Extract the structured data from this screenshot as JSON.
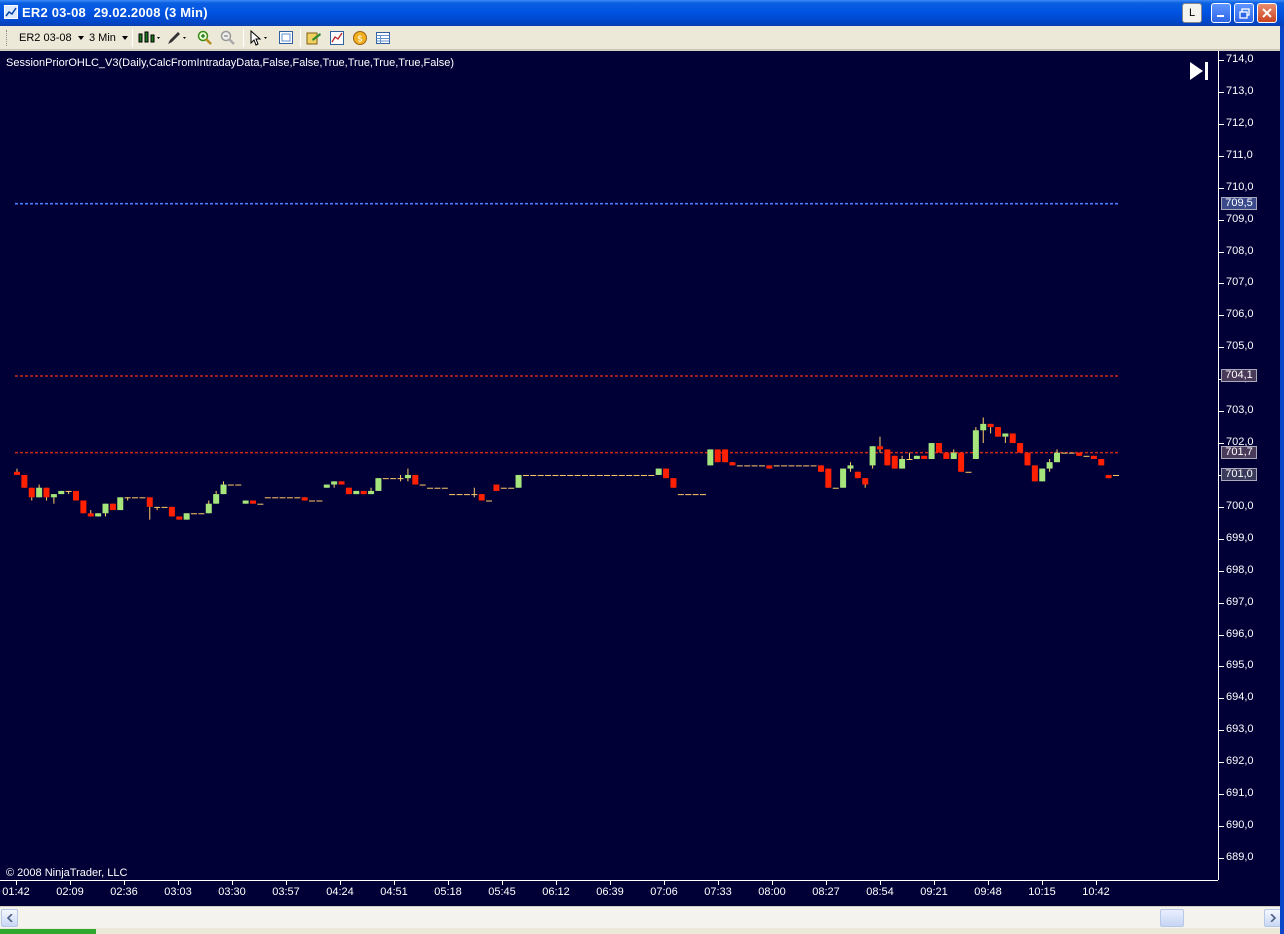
{
  "window": {
    "title": "ER2 03-08  29.02.2008 (3 Min)",
    "buttons": {
      "l_label": "L"
    }
  },
  "toolbar": {
    "instrument": "ER2 03-08",
    "interval": "3 Min",
    "icons": [
      "candlestick-style-icon",
      "drawing-pencil-icon",
      "zoom-in-icon",
      "zoom-out-icon",
      "cursor-icon",
      "data-box-icon",
      "properties-icon",
      "indicators-icon",
      "strategy-icon",
      "order-grid-icon"
    ]
  },
  "chart": {
    "indicator_label": "SessionPriorOHLC_V3(Daily,CalcFromIntradayData,False,False,True,True,True,True,False)",
    "copyright": "© 2008 NinjaTrader, LLC",
    "colors": {
      "background": "#000036",
      "up_bar": "#a6e57c",
      "down_bar": "#ff2000",
      "wick": "#ffcc66",
      "blue_line": "#4a7dff",
      "red_line": "#cc2a1a"
    }
  },
  "chart_data": {
    "type": "candlestick",
    "x_tick_labels": [
      "01:42",
      "02:09",
      "02:36",
      "03:03",
      "03:30",
      "03:57",
      "04:24",
      "04:51",
      "05:18",
      "05:45",
      "06:12",
      "06:39",
      "07:06",
      "07:33",
      "08:00",
      "08:27",
      "08:54",
      "09:21",
      "09:48",
      "10:15",
      "10:42"
    ],
    "y_tick_labels": [
      "714,0",
      "713,0",
      "712,0",
      "711,0",
      "710,0",
      "709,0",
      "708,0",
      "707,0",
      "706,0",
      "705,0",
      "704,0",
      "703,0",
      "702,0",
      "701,0",
      "700,0",
      "699,0",
      "698,0",
      "697,0",
      "696,0",
      "695,0",
      "694,0",
      "693,0",
      "692,0",
      "691,0",
      "690,0",
      "689,0"
    ],
    "ylim": [
      688.8,
      714.1
    ],
    "horizontal_lines": [
      {
        "value": 709.5,
        "label": "709,5",
        "color": "#4a7dff"
      },
      {
        "value": 704.1,
        "label": "704,1",
        "color": "#cc2a1a"
      },
      {
        "value": 701.7,
        "label": "701,7",
        "color": "#cc2a1a"
      }
    ],
    "last_price": {
      "value": 701.0,
      "label": "701,0"
    },
    "bars_count": 160,
    "bars": [
      [
        701.1,
        701.2,
        701.0,
        701.0
      ],
      [
        701.0,
        701.0,
        700.6,
        700.6
      ],
      [
        700.6,
        700.6,
        700.2,
        700.3
      ],
      [
        700.3,
        700.7,
        700.3,
        700.6
      ],
      [
        700.6,
        700.6,
        700.2,
        700.3
      ],
      [
        700.3,
        700.4,
        700.1,
        700.4
      ],
      [
        700.4,
        700.5,
        700.4,
        700.5
      ],
      [
        700.5,
        700.5,
        700.4,
        700.5
      ],
      [
        700.5,
        700.5,
        700.2,
        700.2
      ],
      [
        700.2,
        700.2,
        699.8,
        699.8
      ],
      [
        699.8,
        699.9,
        699.7,
        699.7
      ],
      [
        699.7,
        699.8,
        699.7,
        699.8
      ],
      [
        699.8,
        700.1,
        699.7,
        700.1
      ],
      [
        700.1,
        700.1,
        699.9,
        699.9
      ],
      [
        699.9,
        700.3,
        699.9,
        700.3
      ],
      [
        700.3,
        700.3,
        700.2,
        700.3
      ],
      [
        700.3,
        700.3,
        700.3,
        700.3
      ],
      [
        700.3,
        700.3,
        700.3,
        700.3
      ],
      [
        700.3,
        700.3,
        699.6,
        700.0
      ],
      [
        700.0,
        700.0,
        699.9,
        700.0
      ],
      [
        700.0,
        700.0,
        700.0,
        700.0
      ],
      [
        700.0,
        700.0,
        699.7,
        699.7
      ],
      [
        699.7,
        699.7,
        699.6,
        699.6
      ],
      [
        699.6,
        699.8,
        699.6,
        699.8
      ],
      [
        699.8,
        699.8,
        699.8,
        699.8
      ],
      [
        699.8,
        699.8,
        699.8,
        699.8
      ],
      [
        699.8,
        700.2,
        699.8,
        700.1
      ],
      [
        700.1,
        700.5,
        700.1,
        700.4
      ],
      [
        700.4,
        700.8,
        700.4,
        700.7
      ],
      [
        700.7,
        700.7,
        700.7,
        700.7
      ],
      [
        700.7,
        700.7,
        700.7,
        700.7
      ],
      [
        700.1,
        700.2,
        700.1,
        700.2
      ],
      [
        700.2,
        700.2,
        700.1,
        700.1
      ],
      [
        700.1,
        700.1,
        700.1,
        700.1
      ],
      [
        700.3,
        700.3,
        700.3,
        700.3
      ],
      [
        700.3,
        700.3,
        700.3,
        700.3
      ],
      [
        700.3,
        700.3,
        700.3,
        700.3
      ],
      [
        700.3,
        700.3,
        700.3,
        700.3
      ],
      [
        700.3,
        700.3,
        700.3,
        700.3
      ],
      [
        700.3,
        700.3,
        700.2,
        700.2
      ],
      [
        700.2,
        700.2,
        700.2,
        700.2
      ],
      [
        700.2,
        700.2,
        700.2,
        700.2
      ],
      [
        700.6,
        700.7,
        700.6,
        700.7
      ],
      [
        700.7,
        700.8,
        700.6,
        700.8
      ],
      [
        700.8,
        700.8,
        700.7,
        700.7
      ],
      [
        700.6,
        700.6,
        700.4,
        700.4
      ],
      [
        700.4,
        700.5,
        700.4,
        700.5
      ],
      [
        700.5,
        700.5,
        700.4,
        700.4
      ],
      [
        700.4,
        700.6,
        700.4,
        700.5
      ],
      [
        700.5,
        700.9,
        700.5,
        700.9
      ],
      [
        700.9,
        700.9,
        700.9,
        700.9
      ],
      [
        700.9,
        700.9,
        700.9,
        700.9
      ],
      [
        700.9,
        701.0,
        700.8,
        700.9
      ],
      [
        700.9,
        701.2,
        700.8,
        701.0
      ],
      [
        701.0,
        701.0,
        700.7,
        700.7
      ],
      [
        700.7,
        700.7,
        700.7,
        700.7
      ],
      [
        700.6,
        700.6,
        700.6,
        700.6
      ],
      [
        700.6,
        700.6,
        700.6,
        700.6
      ],
      [
        700.6,
        700.6,
        700.6,
        700.6
      ],
      [
        700.4,
        700.4,
        700.4,
        700.4
      ],
      [
        700.4,
        700.4,
        700.4,
        700.4
      ],
      [
        700.4,
        700.4,
        700.4,
        700.4
      ],
      [
        700.4,
        700.6,
        700.3,
        700.4
      ],
      [
        700.4,
        700.4,
        700.2,
        700.2
      ],
      [
        700.2,
        700.2,
        700.2,
        700.2
      ],
      [
        700.7,
        700.7,
        700.5,
        700.5
      ],
      [
        700.6,
        700.6,
        700.6,
        700.6
      ],
      [
        700.6,
        700.6,
        700.6,
        700.6
      ],
      [
        700.6,
        701.0,
        700.6,
        701.0
      ],
      [
        701.0,
        701.0,
        701.0,
        701.0
      ],
      [
        701.0,
        701.0,
        701.0,
        701.0
      ],
      [
        701.0,
        701.0,
        701.0,
        701.0
      ],
      [
        701.0,
        701.0,
        701.0,
        701.0
      ],
      [
        701.0,
        701.0,
        701.0,
        701.0
      ],
      [
        701.0,
        701.0,
        701.0,
        701.0
      ],
      [
        701.0,
        701.0,
        701.0,
        701.0
      ],
      [
        701.0,
        701.0,
        701.0,
        701.0
      ],
      [
        701.0,
        701.0,
        701.0,
        701.0
      ],
      [
        701.0,
        701.0,
        701.0,
        701.0
      ],
      [
        701.0,
        701.0,
        701.0,
        701.0
      ],
      [
        701.0,
        701.0,
        701.0,
        701.0
      ],
      [
        701.0,
        701.0,
        701.0,
        701.0
      ],
      [
        701.0,
        701.0,
        701.0,
        701.0
      ],
      [
        701.0,
        701.0,
        701.0,
        701.0
      ],
      [
        701.0,
        701.0,
        701.0,
        701.0
      ],
      [
        701.0,
        701.0,
        701.0,
        701.0
      ],
      [
        701.0,
        701.0,
        701.0,
        701.0
      ],
      [
        701.0,
        701.2,
        701.0,
        701.2
      ],
      [
        701.2,
        701.2,
        700.9,
        700.9
      ],
      [
        700.9,
        700.9,
        700.6,
        700.6
      ],
      [
        700.4,
        700.4,
        700.4,
        700.4
      ],
      [
        700.4,
        700.4,
        700.4,
        700.4
      ],
      [
        700.4,
        700.4,
        700.4,
        700.4
      ],
      [
        700.4,
        700.4,
        700.4,
        700.4
      ],
      [
        701.3,
        701.8,
        701.3,
        701.8
      ],
      [
        701.8,
        701.8,
        701.4,
        701.4
      ],
      [
        701.8,
        701.8,
        701.4,
        701.4
      ],
      [
        701.4,
        701.4,
        701.3,
        701.3
      ],
      [
        701.3,
        701.3,
        701.3,
        701.3
      ],
      [
        701.3,
        701.3,
        701.3,
        701.3
      ],
      [
        701.3,
        701.3,
        701.3,
        701.3
      ],
      [
        701.3,
        701.3,
        701.3,
        701.3
      ],
      [
        701.3,
        701.3,
        701.2,
        701.2
      ],
      [
        701.3,
        701.3,
        701.3,
        701.3
      ],
      [
        701.3,
        701.3,
        701.3,
        701.3
      ],
      [
        701.3,
        701.3,
        701.3,
        701.3
      ],
      [
        701.3,
        701.3,
        701.3,
        701.3
      ],
      [
        701.3,
        701.3,
        701.3,
        701.3
      ],
      [
        701.3,
        701.3,
        701.3,
        701.3
      ],
      [
        701.3,
        701.3,
        701.1,
        701.1
      ],
      [
        701.2,
        701.2,
        700.6,
        700.6
      ],
      [
        700.6,
        700.6,
        700.6,
        700.6
      ],
      [
        700.6,
        701.2,
        700.6,
        701.2
      ],
      [
        701.2,
        701.4,
        701.1,
        701.3
      ],
      [
        701.1,
        701.1,
        700.9,
        700.9
      ],
      [
        700.9,
        700.9,
        700.6,
        700.7
      ],
      [
        701.3,
        701.9,
        701.2,
        701.9
      ],
      [
        701.9,
        702.2,
        701.7,
        701.8
      ],
      [
        701.8,
        701.8,
        701.3,
        701.3
      ],
      [
        701.6,
        701.6,
        701.2,
        701.2
      ],
      [
        701.2,
        701.6,
        701.2,
        701.5
      ],
      [
        701.5,
        701.7,
        701.5,
        701.5
      ],
      [
        701.5,
        701.6,
        701.5,
        701.6
      ],
      [
        701.6,
        701.6,
        701.5,
        701.5
      ],
      [
        701.5,
        702.0,
        701.5,
        702.0
      ],
      [
        702.0,
        702.0,
        701.7,
        701.7
      ],
      [
        701.7,
        701.7,
        701.5,
        701.5
      ],
      [
        701.5,
        701.8,
        701.5,
        701.7
      ],
      [
        701.7,
        701.7,
        701.1,
        701.1
      ],
      [
        701.1,
        701.1,
        701.1,
        701.1
      ],
      [
        701.5,
        702.5,
        701.5,
        702.4
      ],
      [
        702.4,
        702.8,
        702.0,
        702.6
      ],
      [
        702.6,
        702.6,
        702.3,
        702.5
      ],
      [
        702.5,
        702.5,
        702.2,
        702.2
      ],
      [
        702.2,
        702.2,
        702.0,
        702.3
      ],
      [
        702.3,
        702.3,
        702.0,
        702.0
      ],
      [
        702.0,
        702.0,
        701.7,
        701.7
      ],
      [
        701.7,
        701.7,
        701.3,
        701.3
      ],
      [
        701.3,
        701.3,
        700.8,
        700.8
      ],
      [
        700.8,
        701.2,
        700.8,
        701.2
      ],
      [
        701.2,
        701.5,
        701.1,
        701.4
      ],
      [
        701.4,
        701.8,
        701.4,
        701.7
      ],
      [
        701.7,
        701.7,
        701.7,
        701.7
      ],
      [
        701.7,
        701.7,
        701.7,
        701.7
      ],
      [
        701.7,
        701.7,
        701.6,
        701.6
      ],
      [
        701.6,
        701.6,
        701.6,
        701.6
      ],
      [
        701.6,
        701.6,
        701.5,
        701.5
      ],
      [
        701.5,
        701.5,
        701.3,
        701.3
      ],
      [
        701.0,
        701.0,
        700.9,
        700.9
      ],
      [
        701.0,
        701.0,
        701.0,
        701.0
      ]
    ]
  }
}
